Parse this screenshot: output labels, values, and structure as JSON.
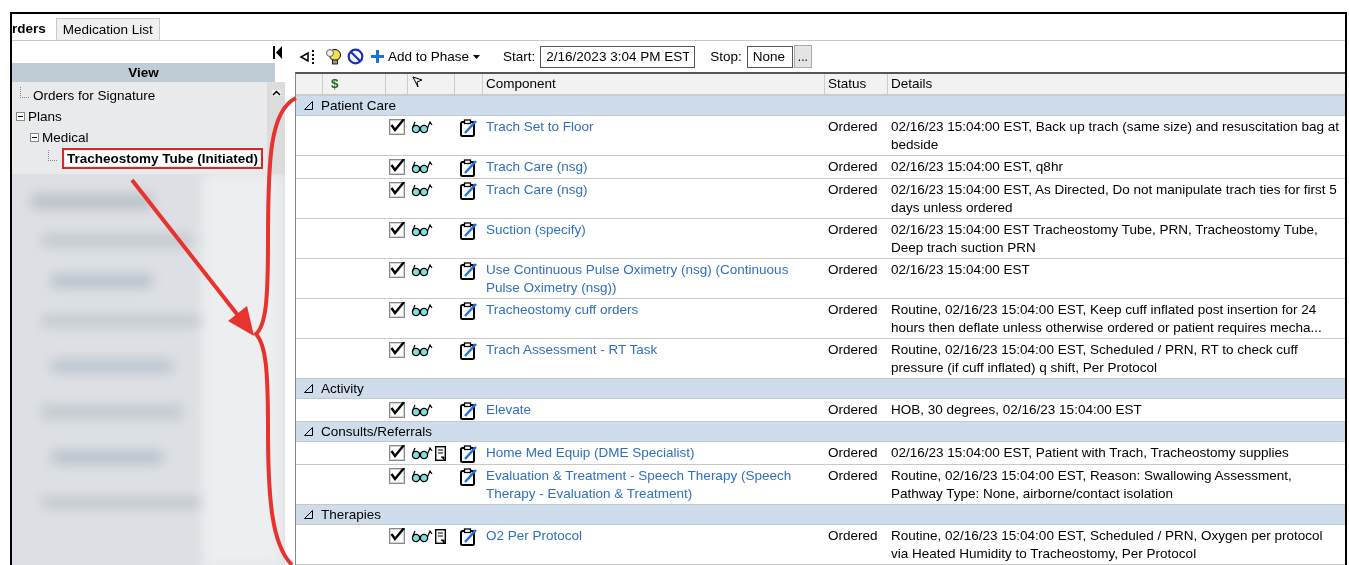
{
  "tabs": [
    {
      "label": "rders",
      "selected": true
    },
    {
      "label": "Medication List",
      "selected": false
    }
  ],
  "sidebar": {
    "header": "View",
    "tree": [
      {
        "label": "Orders for Signature",
        "selected": false
      },
      {
        "label": "Plans",
        "selected": false,
        "expanded": true,
        "children": [
          {
            "label": "Medical",
            "selected": false,
            "expanded": true,
            "children": [
              {
                "label": "Tracheostomy Tube (Initiated)",
                "selected": true
              }
            ]
          }
        ]
      }
    ]
  },
  "toolbar": {
    "add_button": "Add to Phase",
    "start_label": "Start:",
    "start_value": "2/16/2023 3:04 PM EST",
    "stop_label": "Stop:",
    "stop_value": "None",
    "more_button": "..."
  },
  "table": {
    "columns": [
      "$",
      "Component",
      "Status",
      "Details"
    ],
    "groups": [
      {
        "name": "Patient Care",
        "expanded": true,
        "rows": [
          {
            "checked": true,
            "note": false,
            "component": "Trach Set to Floor",
            "status": "Ordered",
            "details": "02/16/23 15:04:00 EST, Back up trach (same size) and resuscitation bag at bedside"
          },
          {
            "checked": true,
            "note": false,
            "component": "Trach Care (nsg)",
            "status": "Ordered",
            "details": "02/16/23 15:04:00 EST, q8hr"
          },
          {
            "checked": true,
            "note": false,
            "component": "Trach Care (nsg)",
            "status": "Ordered",
            "details": "02/16/23 15:04:00 EST, As Directed, Do not manipulate trach ties for first 5 days unless ordered"
          },
          {
            "checked": true,
            "note": false,
            "component": "Suction (specify)",
            "status": "Ordered",
            "details": "02/16/23 15:04:00 EST Tracheostomy Tube, PRN, Tracheostomy Tube, Deep trach suction PRN"
          },
          {
            "checked": true,
            "note": false,
            "component": "Use Continuous Pulse Oximetry (nsg) (Continuous Pulse Oximetry (nsg))",
            "status": "Ordered",
            "details": "02/16/23 15:04:00 EST"
          },
          {
            "checked": true,
            "note": false,
            "component": "Tracheostomy cuff orders",
            "status": "Ordered",
            "details": "Routine, 02/16/23 15:04:00 EST, Keep cuff inflated post insertion for 24 hours then deflate unless otherwise ordered or patient requires mecha..."
          },
          {
            "checked": true,
            "note": false,
            "component": "Trach Assessment - RT Task",
            "status": "Ordered",
            "details": "Routine, 02/16/23 15:04:00 EST, Scheduled / PRN, RT to check cuff pressure (if cuff inflated) q shift, Per Protocol"
          }
        ]
      },
      {
        "name": "Activity",
        "expanded": true,
        "rows": [
          {
            "checked": true,
            "note": false,
            "component": "Elevate",
            "status": "Ordered",
            "details": "HOB, 30 degrees, 02/16/23 15:04:00 EST"
          }
        ]
      },
      {
        "name": "Consults/Referrals",
        "expanded": true,
        "rows": [
          {
            "checked": true,
            "note": true,
            "component": "Home Med Equip (DME Specialist)",
            "status": "Ordered",
            "details": "02/16/23 15:04:00 EST, Patient with Trach, Tracheostomy supplies"
          },
          {
            "checked": true,
            "note": false,
            "component": "Evaluation & Treatment - Speech Therapy (Speech Therapy - Evaluation & Treatment)",
            "status": "Ordered",
            "details": "Routine, 02/16/23 15:04:00 EST, Reason: Swallowing Assessment, Pathway Type: None, airborne/contact isolation"
          }
        ]
      },
      {
        "name": "Therapies",
        "expanded": true,
        "rows": [
          {
            "checked": true,
            "note": true,
            "component": "O2 Per Protocol",
            "status": "Ordered",
            "details": "Routine, 02/16/23 15:04:00 EST, Scheduled / PRN, Oxygen per protocol via Heated Humidity to Tracheostomy, Per Protocol"
          }
        ]
      }
    ]
  }
}
